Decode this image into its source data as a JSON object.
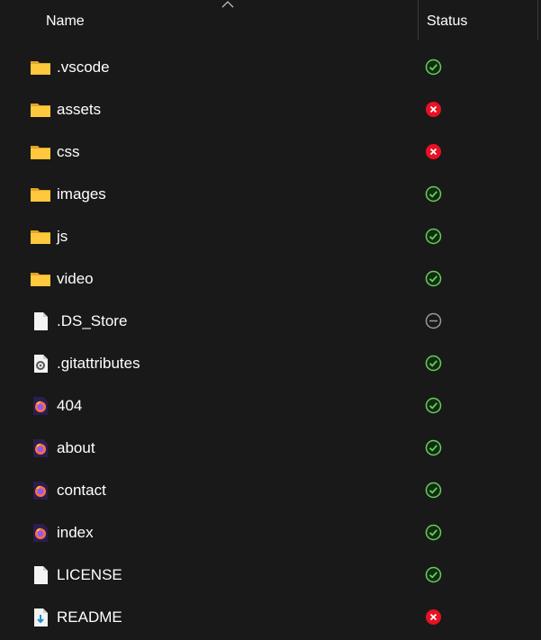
{
  "header": {
    "name_label": "Name",
    "status_label": "Status",
    "sort": "ascending"
  },
  "colors": {
    "background": "#191919",
    "folder": "#ffc83d",
    "synced": "#6ccb5f",
    "error": "#e81123",
    "excluded": "#9a9a9a"
  },
  "items": [
    {
      "name": ".vscode",
      "type": "folder-icon",
      "status": "synced"
    },
    {
      "name": "assets",
      "type": "folder-icon",
      "status": "error"
    },
    {
      "name": "css",
      "type": "folder-icon",
      "status": "error"
    },
    {
      "name": "images",
      "type": "folder-icon",
      "status": "synced"
    },
    {
      "name": "js",
      "type": "folder-icon",
      "status": "synced"
    },
    {
      "name": "video",
      "type": "folder-icon",
      "status": "synced"
    },
    {
      "name": ".DS_Store",
      "type": "file-icon",
      "status": "excluded"
    },
    {
      "name": ".gitattributes",
      "type": "config-file-icon",
      "status": "synced"
    },
    {
      "name": "404",
      "type": "firefox-html-icon",
      "status": "synced"
    },
    {
      "name": "about",
      "type": "firefox-html-icon",
      "status": "synced"
    },
    {
      "name": "contact",
      "type": "firefox-html-icon",
      "status": "synced"
    },
    {
      "name": "index",
      "type": "firefox-html-icon",
      "status": "synced"
    },
    {
      "name": "LICENSE",
      "type": "file-icon",
      "status": "synced"
    },
    {
      "name": "README",
      "type": "markdown-file-icon",
      "status": "error"
    }
  ]
}
